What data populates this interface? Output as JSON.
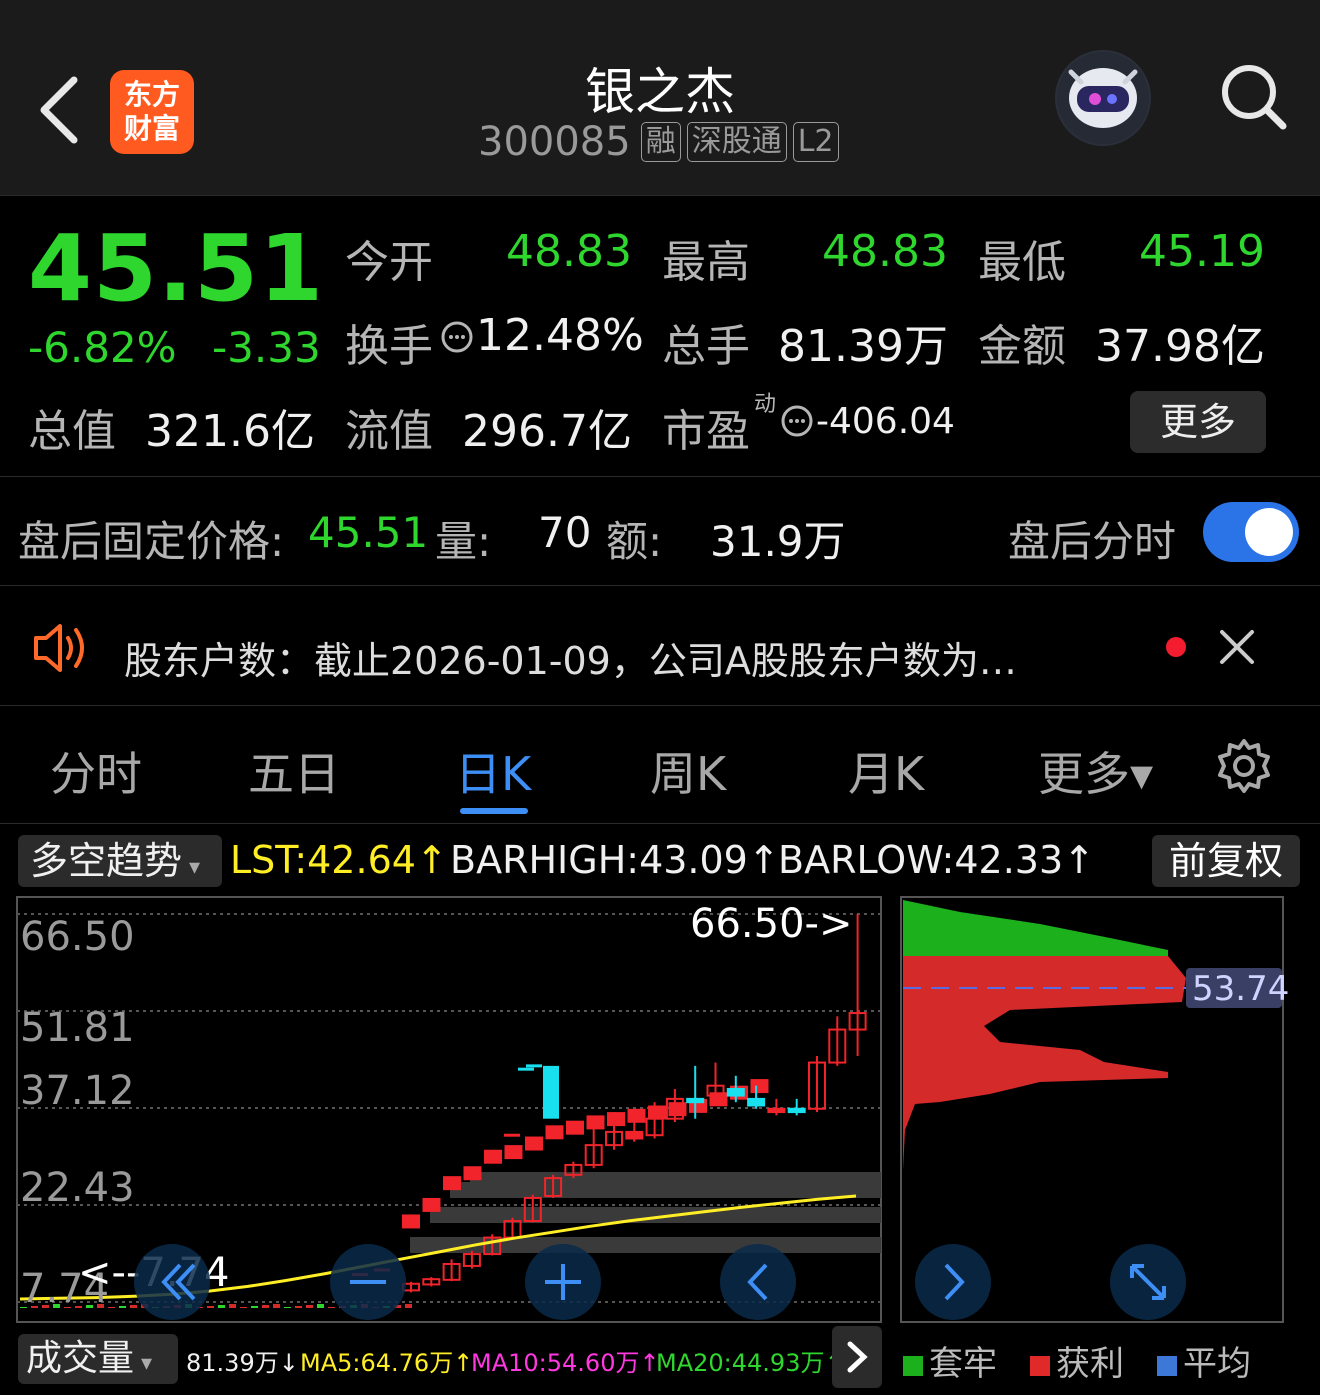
{
  "header": {
    "title": "银之杰",
    "code": "300085",
    "tags": [
      "融",
      "深股通",
      "L2"
    ],
    "logo_line1": "东方",
    "logo_line2": "财富"
  },
  "quote": {
    "price": "45.51",
    "change_pct": "-6.82%",
    "change": "-3.33",
    "open_label": "今开",
    "open": "48.83",
    "high_label": "最高",
    "high": "48.83",
    "low_label": "最低",
    "low": "45.19",
    "turnover_label": "换手",
    "turnover": "12.48%",
    "volume_label": "总手",
    "volume": "81.39万",
    "amount_label": "金额",
    "amount": "37.98亿",
    "mcap_label": "总值",
    "mcap": "321.6亿",
    "float_label": "流值",
    "float": "296.7亿",
    "pe_label": "市盈",
    "pe_sup": "动",
    "pe": "-406.04",
    "more": "更多"
  },
  "after_hours": {
    "price_label": "盘后固定价格:",
    "price": "45.51",
    "vol_label": "量:",
    "vol": "70",
    "amt_label": "额:",
    "amt": "31.9万",
    "toggle_label": "盘后分时",
    "toggle_on": true
  },
  "notice": {
    "text": "股东户数：截止2026-01-09，公司A股股东户数为…"
  },
  "tabs": [
    "分时",
    "五日",
    "日K",
    "周K",
    "月K",
    "更多▾"
  ],
  "active_tab": "日K",
  "indicator": {
    "select": "多空趋势",
    "lst": "LST:42.64↑",
    "barhigh": "BARHIGH:43.09↑",
    "barlow": "BARLOW:42.33↑",
    "adjust": "前复权"
  },
  "chart_data": {
    "type": "candlestick",
    "y_ticks": [
      "66.50",
      "51.81",
      "37.12",
      "22.43",
      "7.74"
    ],
    "ylim": [
      7.74,
      66.5
    ],
    "max_label": "66.50->",
    "min_label": "<--7.74",
    "profile_label": "53.74",
    "candles": [
      {
        "o": 9.5,
        "c": 10.5,
        "h": 10.8,
        "l": 9.2,
        "color": "red"
      },
      {
        "o": 10.4,
        "c": 11.2,
        "h": 11.5,
        "l": 10.1,
        "color": "red"
      },
      {
        "o": 11.1,
        "c": 13.5,
        "h": 14.2,
        "l": 10.9,
        "color": "red"
      },
      {
        "o": 13.2,
        "c": 15.0,
        "h": 15.5,
        "l": 12.8,
        "color": "red"
      },
      {
        "o": 15.0,
        "c": 17.5,
        "h": 18.0,
        "l": 14.8,
        "color": "red"
      },
      {
        "o": 17.5,
        "c": 20.0,
        "h": 20.5,
        "l": 17.2,
        "color": "red"
      },
      {
        "o": 20.0,
        "c": 23.5,
        "h": 24.0,
        "l": 19.8,
        "color": "red"
      },
      {
        "o": 23.8,
        "c": 26.5,
        "h": 27.0,
        "l": 23.5,
        "color": "red"
      },
      {
        "o": 27.0,
        "c": 28.5,
        "h": 29.0,
        "l": 26.5,
        "color": "red"
      },
      {
        "o": 28.5,
        "c": 31.5,
        "h": 35.0,
        "l": 28.0,
        "color": "red"
      },
      {
        "o": 31.5,
        "c": 33.5,
        "h": 36.5,
        "l": 30.8,
        "color": "red"
      },
      {
        "o": 33.5,
        "c": 32.5,
        "h": 36.0,
        "l": 32.0,
        "color": "red"
      },
      {
        "o": 33.0,
        "c": 35.5,
        "h": 38.0,
        "l": 32.5,
        "color": "red"
      },
      {
        "o": 35.5,
        "c": 38.5,
        "h": 40.0,
        "l": 35.0,
        "color": "red"
      },
      {
        "o": 38.5,
        "c": 38.0,
        "h": 43.5,
        "l": 35.5,
        "color": "cyan"
      },
      {
        "o": 39.0,
        "c": 40.5,
        "h": 44.0,
        "l": 38.5,
        "color": "red"
      },
      {
        "o": 40.0,
        "c": 39.0,
        "h": 42.0,
        "l": 38.0,
        "color": "cyan"
      },
      {
        "o": 38.5,
        "c": 37.5,
        "h": 40.5,
        "l": 37.0,
        "color": "cyan"
      },
      {
        "o": 37.0,
        "c": 36.5,
        "h": 38.5,
        "l": 36.0,
        "color": "red"
      },
      {
        "o": 36.5,
        "c": 37.0,
        "h": 38.5,
        "l": 36.0,
        "color": "cyan"
      },
      {
        "o": 37.0,
        "c": 44.0,
        "h": 45.0,
        "l": 36.5,
        "color": "red"
      },
      {
        "o": 44.0,
        "c": 49.0,
        "h": 51.0,
        "l": 43.5,
        "color": "red"
      },
      {
        "o": 49.0,
        "c": 51.5,
        "h": 66.5,
        "l": 45.0,
        "color": "red"
      }
    ],
    "dashes": [
      {
        "v": 11.9,
        "color": "red"
      },
      {
        "v": 12.6,
        "color": "red"
      },
      {
        "v": 29.0,
        "color": "red"
      },
      {
        "v": 33.0,
        "color": "red"
      },
      {
        "v": 43.0,
        "color": "cyan"
      },
      {
        "v": 43.5,
        "color": "cyan"
      }
    ],
    "trend_blocks": [
      {
        "o": 13.5,
        "c": 21.0,
        "color": "red"
      },
      {
        "o": 15.0,
        "c": 23.5,
        "color": "red"
      },
      {
        "o": 17.5,
        "c": 26.8,
        "color": "red"
      },
      {
        "o": 26.5,
        "c": 28.3,
        "color": "red"
      },
      {
        "o": 27.5,
        "c": 30.8,
        "color": "red"
      },
      {
        "o": 29.0,
        "c": 31.5,
        "color": "red"
      },
      {
        "o": 30.5,
        "c": 32.8,
        "color": "red"
      },
      {
        "o": 31.5,
        "c": 34.5,
        "color": "red"
      },
      {
        "o": 33.0,
        "c": 35.2,
        "color": "red"
      },
      {
        "o": 34.0,
        "c": 36.0,
        "color": "red"
      },
      {
        "o": 35.0,
        "c": 36.5,
        "color": "red"
      },
      {
        "o": 35.5,
        "c": 37.0,
        "color": "red"
      },
      {
        "o": 35.8,
        "c": 37.5,
        "color": "red"
      },
      {
        "o": 36.0,
        "c": 38.0,
        "color": "red"
      },
      {
        "o": 36.5,
        "c": 38.5,
        "color": "red"
      },
      {
        "o": 37.5,
        "c": 39.5,
        "color": "red"
      },
      {
        "o": 38.5,
        "c": 40.5,
        "color": "red"
      },
      {
        "o": 39.5,
        "c": 41.5,
        "color": "red"
      }
    ],
    "ma_line": [
      8.2,
      8.3,
      8.4,
      8.6,
      8.9,
      9.4,
      10.1,
      11.0,
      12.0,
      13.1,
      14.2,
      15.3,
      16.4,
      17.4,
      18.3,
      19.2,
      20.0,
      20.7,
      21.4,
      22.1,
      22.7,
      23.3,
      23.8
    ]
  },
  "volume_bar": {
    "select": "成交量",
    "vol": "81.39万↓",
    "ma5": "MA5:64.76万↑",
    "ma10": "MA10:54.60万↑",
    "ma20": "MA20:44.93万↑"
  },
  "legend": [
    "套牢",
    "获利",
    "平均"
  ],
  "colors": {
    "up": "#f0242a",
    "down": "#2ed62e",
    "cyan": "#19e0ee",
    "accent": "#3d8ef5",
    "ma": "#ffee26"
  }
}
